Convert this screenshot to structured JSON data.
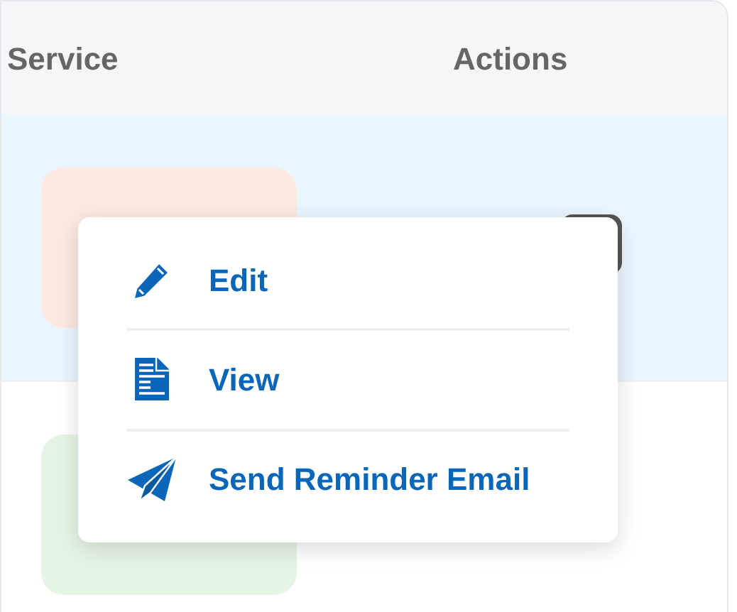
{
  "table": {
    "columns": [
      "Service",
      "Actions"
    ],
    "rows": [
      {
        "selected": true,
        "service": {
          "color": "#fce9e0"
        }
      },
      {
        "selected": false,
        "service": {
          "color": "#e6f4e6"
        }
      }
    ]
  },
  "menu": {
    "items": [
      {
        "kind": "edit",
        "label": "Edit"
      },
      {
        "kind": "view",
        "label": "View"
      },
      {
        "kind": "send",
        "label": "Send Reminder Email"
      }
    ]
  }
}
